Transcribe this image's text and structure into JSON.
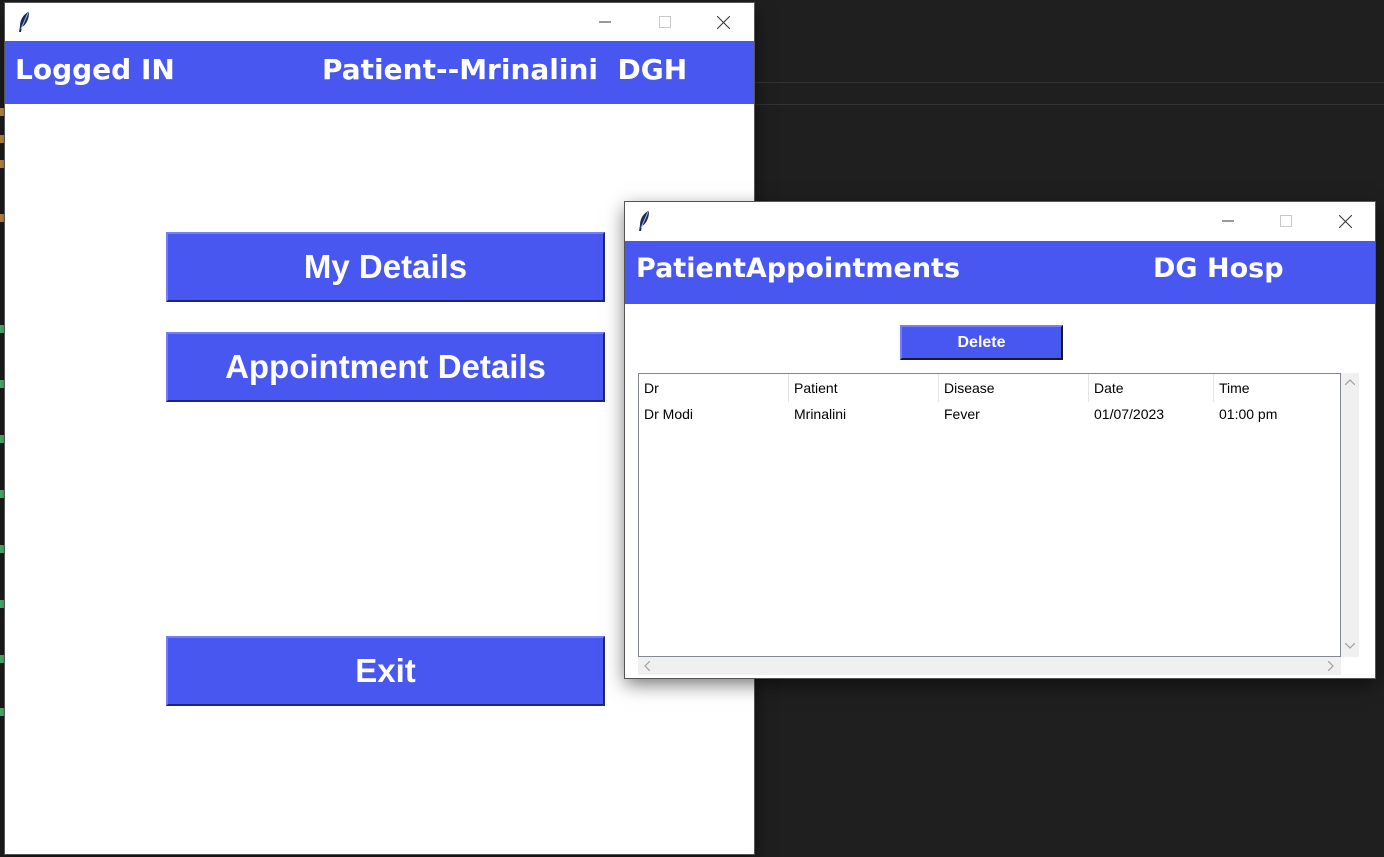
{
  "main_window": {
    "banner_left": "Logged IN",
    "banner_right": "Patient--Mrinalini  DGH",
    "buttons": {
      "my_details": "My Details",
      "appointment_details": "Appointment Details",
      "exit": "Exit"
    }
  },
  "appointments_window": {
    "banner_left": "PatientAppointments",
    "banner_right": "DG Hosp",
    "delete_label": "Delete",
    "table": {
      "columns": [
        "Dr",
        "Patient",
        "Disease",
        "Date",
        "Time"
      ],
      "rows": [
        [
          "Dr Modi",
          "Mrinalini",
          "Fever",
          "01/07/2023",
          "01:00 pm"
        ]
      ]
    }
  },
  "colors": {
    "accent": "#4757f0",
    "background": "#1f1f1f"
  }
}
